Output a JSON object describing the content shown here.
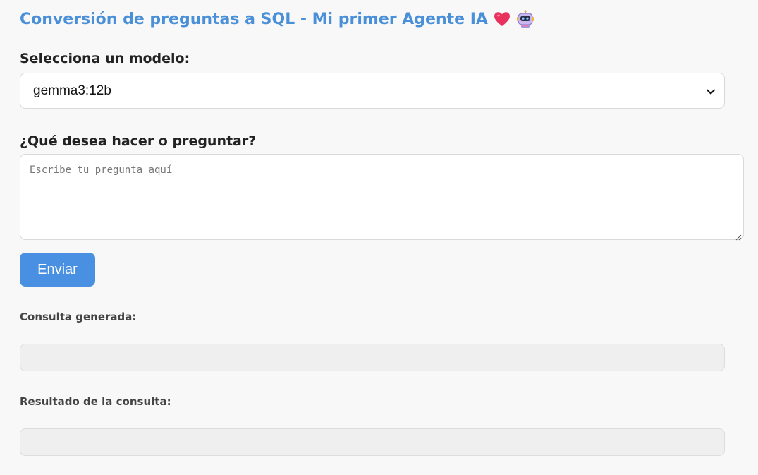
{
  "header": {
    "title": "Conversión de preguntas a SQL - Mi primer Agente IA",
    "title_icons": [
      "heart-icon",
      "robot-icon"
    ]
  },
  "model": {
    "label": "Selecciona un modelo:",
    "selected": "gemma3:12b"
  },
  "question": {
    "label": "¿Qué desea hacer o preguntar?",
    "value": "",
    "placeholder": "Escribe tu pregunta aquí"
  },
  "actions": {
    "send_label": "Enviar"
  },
  "generated_query": {
    "label": "Consulta generada:",
    "value": ""
  },
  "query_result": {
    "label": "Resultado de la consulta:",
    "value": ""
  },
  "colors": {
    "accent": "#4a90e2",
    "title": "#4a90d9",
    "background": "#f8f8f8",
    "output_background": "#efefef",
    "heart": "#e8315b"
  }
}
